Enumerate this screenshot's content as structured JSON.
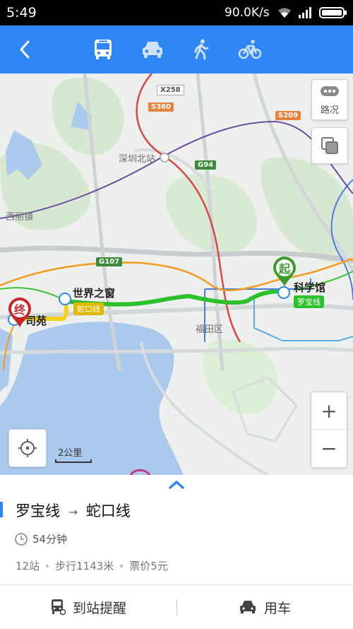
{
  "status_bar": {
    "time": "5:49",
    "network_speed": "90.0K/s"
  },
  "nav": {
    "tabs": [
      "bus",
      "car",
      "walk",
      "bike"
    ],
    "selected": "bus",
    "colors": {
      "bar": "#2f86f5"
    }
  },
  "map": {
    "traffic_label": "路况",
    "scale_label": "2公里",
    "place_labels": {
      "shenzhen_north": "深圳北站",
      "xili": "西丽镇",
      "futian": "福田区",
      "window": "世界之窗",
      "science": "科学馆",
      "end_station": "司苑"
    },
    "road_shields": {
      "x258": "X258",
      "s360": "S360",
      "s209": "S209",
      "g94": "G94",
      "g107": "G107"
    },
    "line_badges": {
      "shekou": "蛇口线",
      "luobao": "罗宝线"
    },
    "markers": {
      "start": "起",
      "end": "终"
    },
    "zoom_in": "+",
    "zoom_out": "−",
    "colors": {
      "route": "#2bc12b",
      "shekou_line": "#f5d216",
      "start_marker": "#3a9a2a",
      "end_marker": "#c62828"
    }
  },
  "route": {
    "title_from": "罗宝线",
    "arrow": "→",
    "title_to": "蛇口线",
    "duration": "54分钟",
    "stops": "12站",
    "walk": "步行1143米",
    "fare": "票价5元"
  },
  "actions": {
    "remind": "到站提醒",
    "car": "用车"
  }
}
